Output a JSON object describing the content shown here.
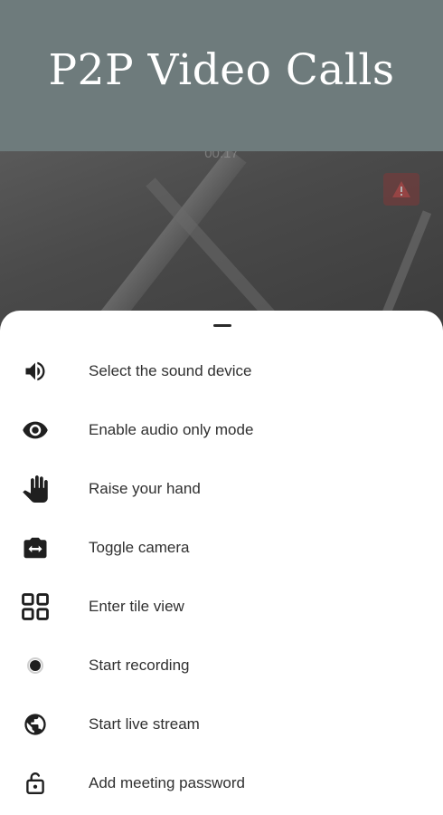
{
  "banner": {
    "title": "P2P Video Calls"
  },
  "video": {
    "timer": "00:17",
    "warning_icon": "warning-icon"
  },
  "menu": {
    "items": [
      {
        "label": "Select the sound device",
        "icon": "speaker-icon"
      },
      {
        "label": "Enable audio only mode",
        "icon": "eye-icon"
      },
      {
        "label": "Raise your hand",
        "icon": "hand-icon"
      },
      {
        "label": "Toggle camera",
        "icon": "switch-camera-icon"
      },
      {
        "label": "Enter tile view",
        "icon": "tile-view-icon"
      },
      {
        "label": "Start recording",
        "icon": "record-icon"
      },
      {
        "label": "Start live stream",
        "icon": "globe-icon"
      },
      {
        "label": "Add meeting password",
        "icon": "lock-icon"
      }
    ]
  }
}
